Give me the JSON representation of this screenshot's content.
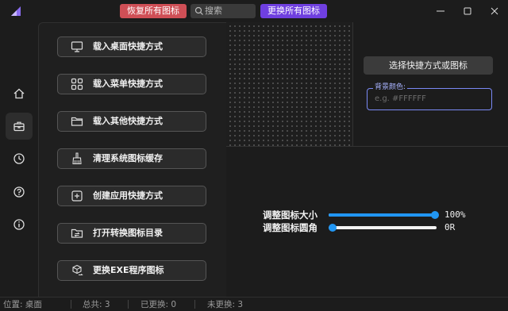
{
  "titlebar": {
    "restore_all_label": "恢复所有图标",
    "search_placeholder": "搜索",
    "replace_all_label": "更换所有图标",
    "colors": {
      "restore": "#cf4f56",
      "replace": "#6f3fe0"
    }
  },
  "sidebar": {
    "items": [
      {
        "name": "home",
        "icon": "home-icon",
        "active": false
      },
      {
        "name": "toolbox",
        "icon": "toolbox-icon",
        "active": true
      },
      {
        "name": "history",
        "icon": "clock-icon",
        "active": false
      },
      {
        "name": "help",
        "icon": "question-icon",
        "active": false
      },
      {
        "name": "about",
        "icon": "info-icon",
        "active": false
      }
    ]
  },
  "actions": [
    {
      "label": "载入桌面快捷方式",
      "icon": "monitor-icon"
    },
    {
      "label": "载入菜单快捷方式",
      "icon": "grid-icon"
    },
    {
      "label": "载入其他快捷方式",
      "icon": "folder-icon"
    },
    {
      "label": "清理系统图标缓存",
      "icon": "broom-icon"
    },
    {
      "label": "创建应用快捷方式",
      "icon": "plus-square-icon"
    },
    {
      "label": "打开转换图标目录",
      "icon": "folder-convert-icon"
    },
    {
      "label": "更换EXE程序图标",
      "icon": "cube-swap-icon"
    }
  ],
  "right_panel": {
    "choose_button": "选择快捷方式或图标",
    "bg_color_label": "背景颜色:",
    "bg_color_placeholder": "e.g. #FFFFFF",
    "accent": "#7a89f5"
  },
  "sliders": [
    {
      "label": "调整图标大小",
      "value_text": "100%",
      "level": 1.0
    },
    {
      "label": "调整图标圆角",
      "value_text": "0R",
      "level": 0.0
    }
  ],
  "status": {
    "location": "位置: 桌面",
    "total": "总共: 3",
    "replaced": "已更换: 0",
    "not_replaced": "未更换: 3"
  }
}
